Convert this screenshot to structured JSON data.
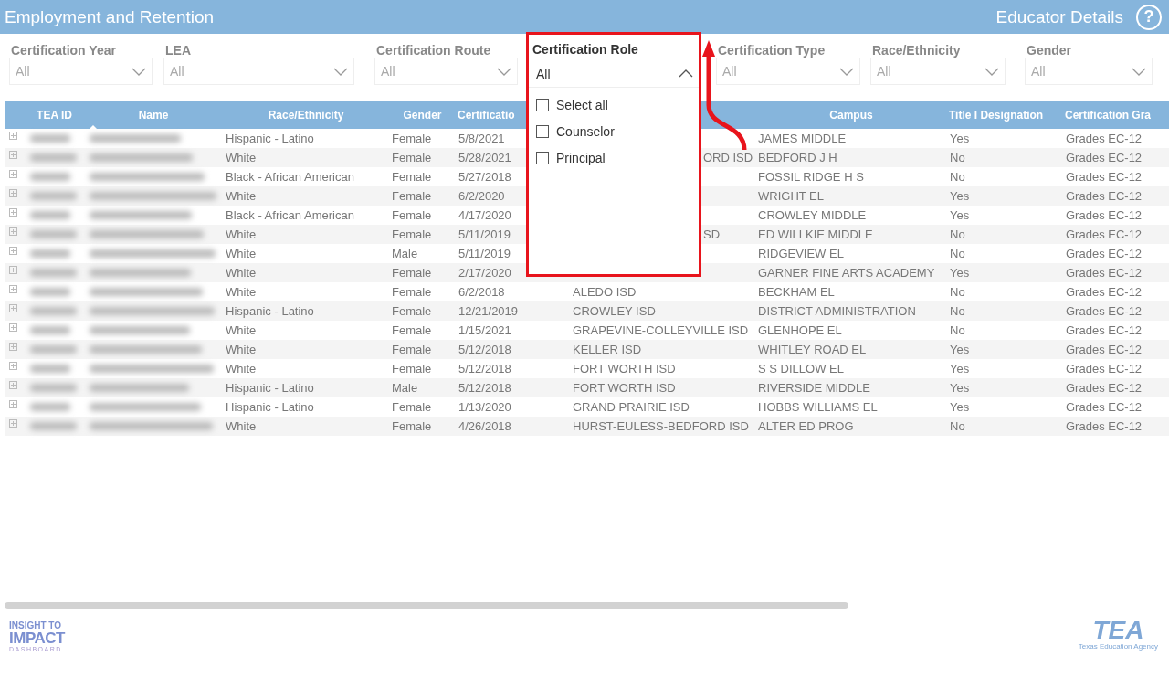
{
  "header": {
    "title": "Employment and Retention",
    "page_title": "Educator Details",
    "help": "?"
  },
  "filters": [
    {
      "label": "Certification Year",
      "value": "All",
      "expanded": false
    },
    {
      "label": "LEA",
      "value": "All",
      "expanded": false
    },
    {
      "label": "Certification Route",
      "value": "All",
      "expanded": false
    },
    {
      "label": "Certification Role",
      "value": "All",
      "expanded": true,
      "options": [
        {
          "label": "Select all",
          "checked": false
        },
        {
          "label": "Counselor",
          "checked": false
        },
        {
          "label": "Principal",
          "checked": false
        }
      ]
    },
    {
      "label": "Certification Type",
      "value": "All",
      "expanded": false
    },
    {
      "label": "Race/Ethnicity",
      "value": "All",
      "expanded": false
    },
    {
      "label": "Gender",
      "value": "All",
      "expanded": false
    }
  ],
  "table": {
    "columns": [
      "TEA ID",
      "Name",
      "Race/Ethnicity",
      "Gender",
      "Certificatio",
      "Campus",
      "Title I Designation",
      "Certification Gra"
    ],
    "rows": [
      {
        "race": "Hispanic - Latino",
        "gender": "Female",
        "date": "5/8/2021",
        "campus": "JAMES MIDDLE",
        "title_i": "Yes",
        "grades": "Grades EC-12"
      },
      {
        "race": "White",
        "gender": "Female",
        "date": "5/28/2021",
        "lea": "ORD ISD",
        "lea_partial": true,
        "campus": "BEDFORD J H",
        "title_i": "No",
        "grades": "Grades EC-12"
      },
      {
        "race": "Black - African American",
        "gender": "Female",
        "date": "5/27/2018",
        "campus": "FOSSIL RIDGE H S",
        "title_i": "No",
        "grades": "Grades EC-12"
      },
      {
        "race": "White",
        "gender": "Female",
        "date": "6/2/2020",
        "campus": "WRIGHT EL",
        "title_i": "Yes",
        "grades": "Grades EC-12"
      },
      {
        "race": "Black - African American",
        "gender": "Female",
        "date": "4/17/2020",
        "campus": "CROWLEY MIDDLE",
        "title_i": "Yes",
        "grades": "Grades EC-12"
      },
      {
        "race": "White",
        "gender": "Female",
        "date": "5/11/2019",
        "lea": "SD",
        "lea_partial": true,
        "campus": "ED WILLKIE MIDDLE",
        "title_i": "No",
        "grades": "Grades EC-12"
      },
      {
        "race": "White",
        "gender": "Male",
        "date": "5/11/2019",
        "campus": "RIDGEVIEW EL",
        "title_i": "No",
        "grades": "Grades EC-12"
      },
      {
        "race": "White",
        "gender": "Female",
        "date": "2/17/2020",
        "campus": "GARNER FINE ARTS ACADEMY",
        "title_i": "Yes",
        "grades": "Grades EC-12"
      },
      {
        "race": "White",
        "gender": "Female",
        "date": "6/2/2018",
        "lea": "ALEDO ISD",
        "campus": "BECKHAM EL",
        "title_i": "No",
        "grades": "Grades EC-12"
      },
      {
        "race": "Hispanic - Latino",
        "gender": "Female",
        "date": "12/21/2019",
        "lea": "CROWLEY ISD",
        "campus": "DISTRICT ADMINISTRATION",
        "title_i": "No",
        "grades": "Grades EC-12"
      },
      {
        "race": "White",
        "gender": "Female",
        "date": "1/15/2021",
        "lea": "GRAPEVINE-COLLEYVILLE ISD",
        "campus": "GLENHOPE EL",
        "title_i": "No",
        "grades": "Grades EC-12"
      },
      {
        "race": "White",
        "gender": "Female",
        "date": "5/12/2018",
        "lea": "KELLER ISD",
        "campus": "WHITLEY ROAD EL",
        "title_i": "Yes",
        "grades": "Grades EC-12"
      },
      {
        "race": "White",
        "gender": "Female",
        "date": "5/12/2018",
        "lea": "FORT WORTH ISD",
        "campus": "S S DILLOW EL",
        "title_i": "Yes",
        "grades": "Grades EC-12"
      },
      {
        "race": "Hispanic - Latino",
        "gender": "Male",
        "date": "5/12/2018",
        "lea": "FORT WORTH ISD",
        "campus": "RIVERSIDE MIDDLE",
        "title_i": "Yes",
        "grades": "Grades EC-12"
      },
      {
        "race": "Hispanic - Latino",
        "gender": "Female",
        "date": "1/13/2020",
        "lea": "GRAND PRAIRIE ISD",
        "campus": "HOBBS WILLIAMS EL",
        "title_i": "Yes",
        "grades": "Grades EC-12"
      },
      {
        "race": "White",
        "gender": "Female",
        "date": "4/26/2018",
        "lea": "HURST-EULESS-BEDFORD ISD",
        "campus": "ALTER ED PROG",
        "title_i": "No",
        "grades": "Grades EC-12"
      }
    ]
  },
  "footer": {
    "left_logo": [
      "INSIGHT TO",
      "IMPACT",
      "DASHBOARD"
    ],
    "right_logo": [
      "TEA",
      "Texas Education Agency"
    ]
  }
}
